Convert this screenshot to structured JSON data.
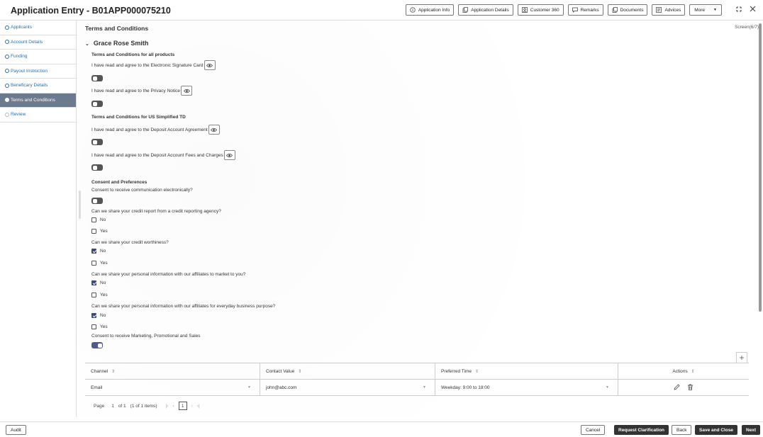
{
  "header": {
    "title": "Application Entry - B01APP000075210",
    "buttons": [
      "Application Info",
      "Application Details",
      "Customer 360",
      "Remarks",
      "Documents",
      "Advices"
    ],
    "more_label": "More"
  },
  "sidebar": {
    "items": [
      {
        "label": "Applicants"
      },
      {
        "label": "Account Details"
      },
      {
        "label": "Funding"
      },
      {
        "label": "Payout Instruction"
      },
      {
        "label": "Beneficary Details"
      },
      {
        "label": "Terms and Conditions"
      },
      {
        "label": "Review"
      }
    ]
  },
  "main": {
    "title": "Terms and Conditions",
    "screen_count": "Screen(6/7)",
    "applicant_name": "Grace Rose Smith",
    "section_all": "Terms and Conditions for all products",
    "agree_esign": "I have read and agree to the Electronic Signature Card",
    "agree_privacy": "I have read and agree to the Privacy Notice",
    "section_td": "Terms and Conditions for US Simplified TD",
    "agree_deposit": "I have read and agree to the Deposit Account Agreement",
    "agree_fees": "I have read and agree to the Deposit Account Fees and Charges",
    "section_consent": "Consent and Preferences",
    "q_electronic": "Consent to receive communication electronically?",
    "q_credit_report": "Can we share your credit report from a credit reporting agency?",
    "q_credit_worth": "Can we share your credit worthiness?",
    "q_affiliates_market": "Can we share your personal information with our affiliates to market to you?",
    "q_affiliates_business": "Can we share your personal information with our affiliates for everyday business purpose?",
    "q_marketing": "Consent to receive Marketing, Promotional and Sales",
    "opt_no": "No",
    "opt_yes": "Yes"
  },
  "table": {
    "headers": [
      "Channel",
      "Contact Value",
      "Preferred Time",
      "Actions"
    ],
    "rows": [
      {
        "channel": "Email",
        "contact": "john@abc.com",
        "time": "Weekday: 9:00 to 18:00"
      }
    ]
  },
  "pager": {
    "page_label": "Page",
    "page_num": "1",
    "of_label": "of 1",
    "items_label": "(1 of 1 items)",
    "current": "1"
  },
  "footer": {
    "audit": "Audit",
    "cancel": "Cancel",
    "request": "Request Clarification",
    "back": "Back",
    "save_close": "Save and Close",
    "next": "Next"
  }
}
